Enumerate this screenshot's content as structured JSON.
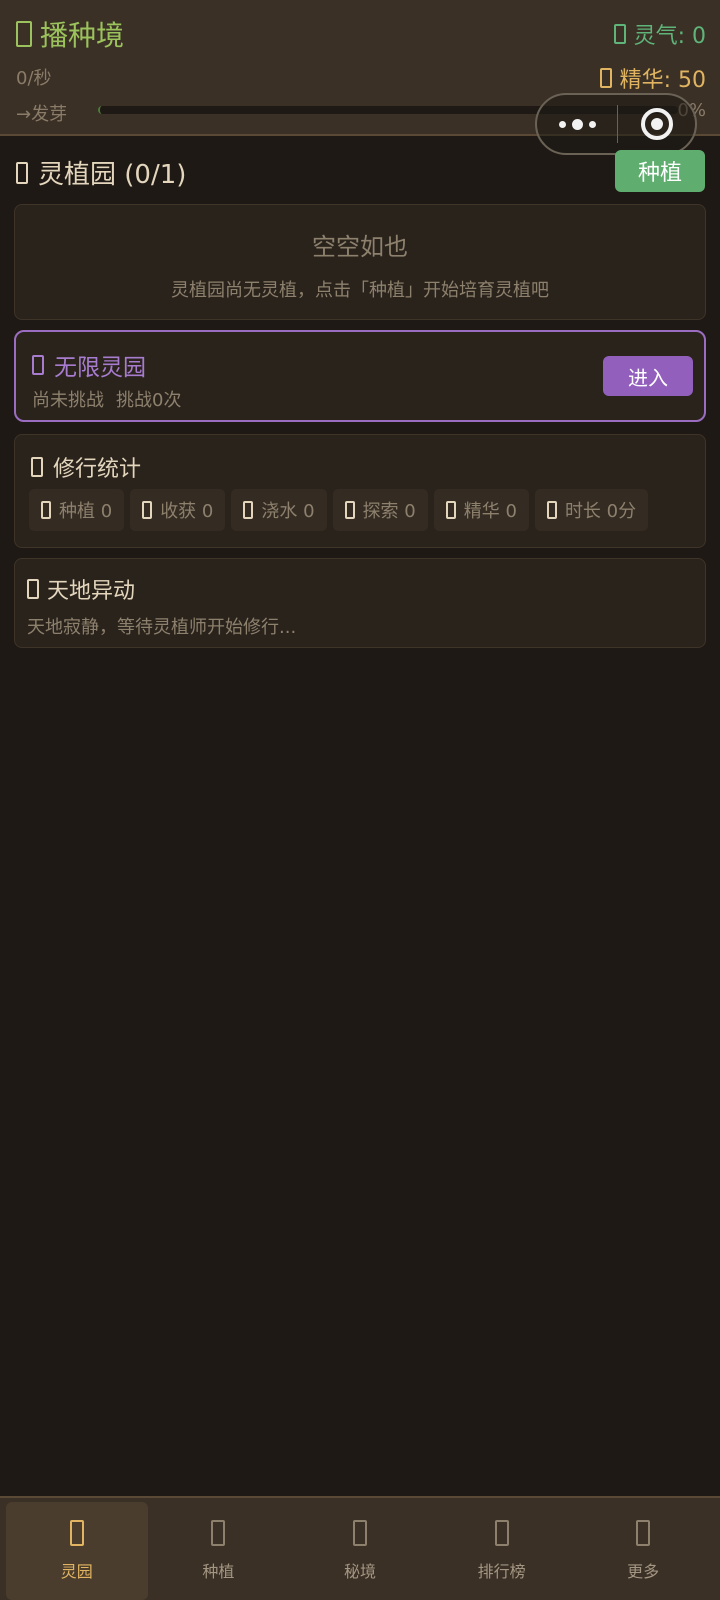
{
  "header": {
    "realm_title": "播种境",
    "qi_label": "灵气: 0",
    "rate": "0/秒",
    "essence_label": "精华: 50",
    "next_stage": "→发芽",
    "progress_pct": "0%",
    "progress_value": 0
  },
  "garden": {
    "title": "灵植园 (0/1)",
    "plant_button": "种植",
    "empty_title": "空空如也",
    "empty_desc": "灵植园尚无灵植，点击「种植」开始培育灵植吧"
  },
  "infinite": {
    "title": "无限灵园",
    "status": "尚未挑战",
    "count": "挑战0次",
    "enter_button": "进入"
  },
  "stats": {
    "title": "修行统计",
    "chips": [
      "种植 0",
      "收获 0",
      "浇水 0",
      "探索 0",
      "精华 0",
      "时长 0分"
    ]
  },
  "events": {
    "title": "天地异动",
    "desc": "天地寂静，等待灵植师开始修行..."
  },
  "tabs": [
    {
      "label": "灵园",
      "active": true
    },
    {
      "label": "种植",
      "active": false
    },
    {
      "label": "秘境",
      "active": false
    },
    {
      "label": "排行榜",
      "active": false
    },
    {
      "label": "更多",
      "active": false
    }
  ],
  "colors": {
    "realm": "#9bc25c",
    "qi": "#5fb47a",
    "essence": "#e0b461",
    "infinite": "#a77ccf",
    "plant_button": "#5fae6f",
    "enter_button": "#925fbd",
    "background": "#1e1914"
  }
}
